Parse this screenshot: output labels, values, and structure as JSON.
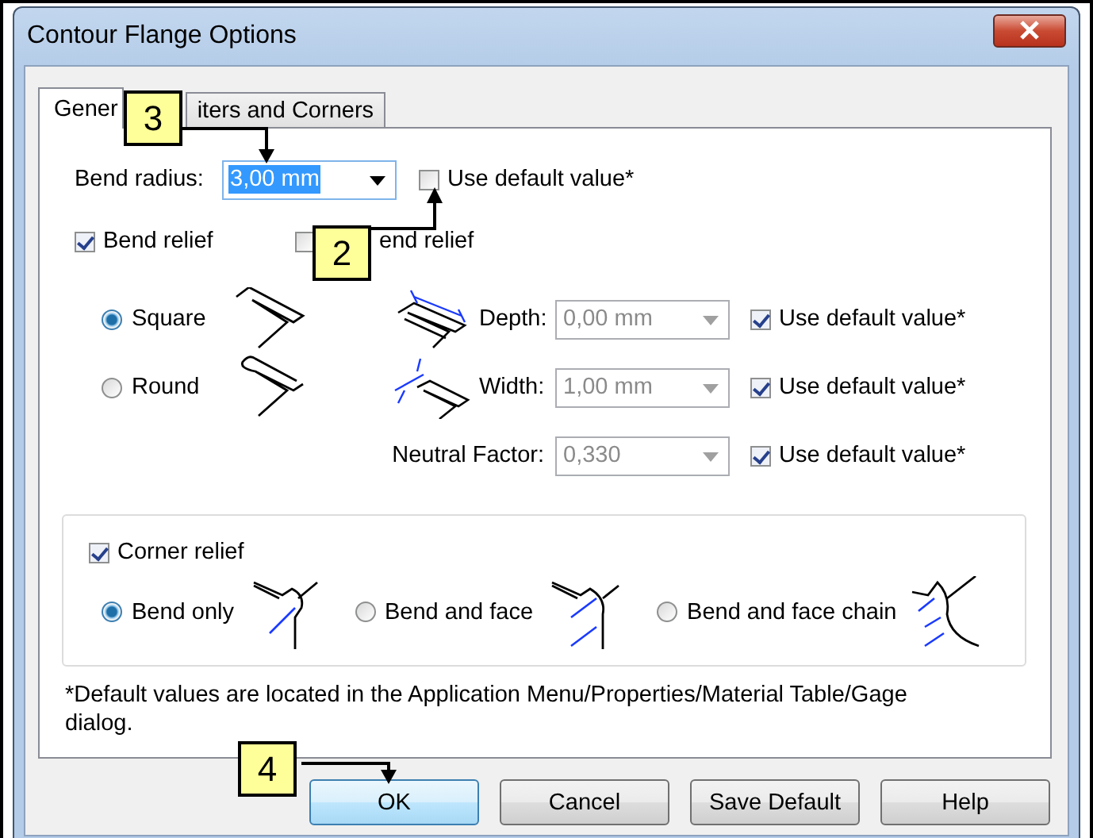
{
  "window": {
    "title": "Contour Flange Options"
  },
  "tabs": [
    {
      "label": "Gener",
      "selected": true
    },
    {
      "label": "iters and Corners",
      "selected": false
    }
  ],
  "bend_radius": {
    "label": "Bend radius:",
    "value": "3,00 mm",
    "highlighted": true,
    "use_default": {
      "label": "Use default value*",
      "checked": false
    }
  },
  "relief_checks": [
    {
      "label": "Bend relief",
      "checked": true
    },
    {
      "label": "end relief",
      "checked": false
    }
  ],
  "relief_shapes": [
    {
      "label": "Square",
      "selected": true,
      "kind": "square"
    },
    {
      "label": "Round",
      "selected": false,
      "kind": "round"
    }
  ],
  "parameters": [
    {
      "label": "Depth:",
      "value": "0,00 mm",
      "disabled": true,
      "kind": "depth",
      "use_default": {
        "label": "Use default value*",
        "checked": true
      }
    },
    {
      "label": "Width:",
      "value": "1,00 mm",
      "disabled": true,
      "kind": "width",
      "use_default": {
        "label": "Use default value*",
        "checked": true
      }
    },
    {
      "label": "Neutral Factor:",
      "value": "0,330",
      "disabled": true,
      "kind": "none",
      "use_default": {
        "label": "Use default value*",
        "checked": true
      }
    }
  ],
  "corner_relief": {
    "label": "Corner relief",
    "checked": true,
    "options": [
      {
        "label": "Bend only",
        "selected": true,
        "kind": "bend"
      },
      {
        "label": "Bend and face",
        "selected": false,
        "kind": "face"
      },
      {
        "label": "Bend and face chain",
        "selected": false,
        "kind": "chain"
      }
    ]
  },
  "footnote": "*Default values are located in the Application Menu/Properties/Material Table/Gage dialog.",
  "buttons": [
    {
      "label": "OK",
      "default": true
    },
    {
      "label": "Cancel",
      "default": false
    },
    {
      "label": "Save Default",
      "default": false
    },
    {
      "label": "Help",
      "default": false
    }
  ],
  "callouts": [
    {
      "label": "3",
      "kind": "radius"
    },
    {
      "label": "2",
      "kind": "checkbox"
    },
    {
      "label": "4",
      "kind": "ok"
    }
  ]
}
